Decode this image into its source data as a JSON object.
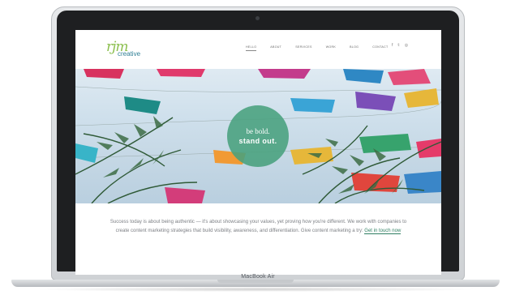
{
  "device": {
    "label": "MacBook Air"
  },
  "site": {
    "logo": {
      "mark": "rjm",
      "word": "creative"
    },
    "nav": [
      {
        "label": "HELLO",
        "active": true
      },
      {
        "label": "ABOUT"
      },
      {
        "label": "SERVICES"
      },
      {
        "label": "WORK"
      },
      {
        "label": "BLOG"
      },
      {
        "label": "CONTACT"
      }
    ],
    "social": [
      "f",
      "t",
      "ig"
    ],
    "hero": {
      "line1": "be bold.",
      "line2": "stand out.",
      "badge_color": "#48a07d"
    },
    "intro": {
      "text": "Success today is about being authentic — it's about showcasing your values, yet proving how you're different. We work with companies to create content marketing strategies that build visibility, awareness, and differentiation. Give content marketing a try: ",
      "link": "Get in touch now"
    }
  }
}
